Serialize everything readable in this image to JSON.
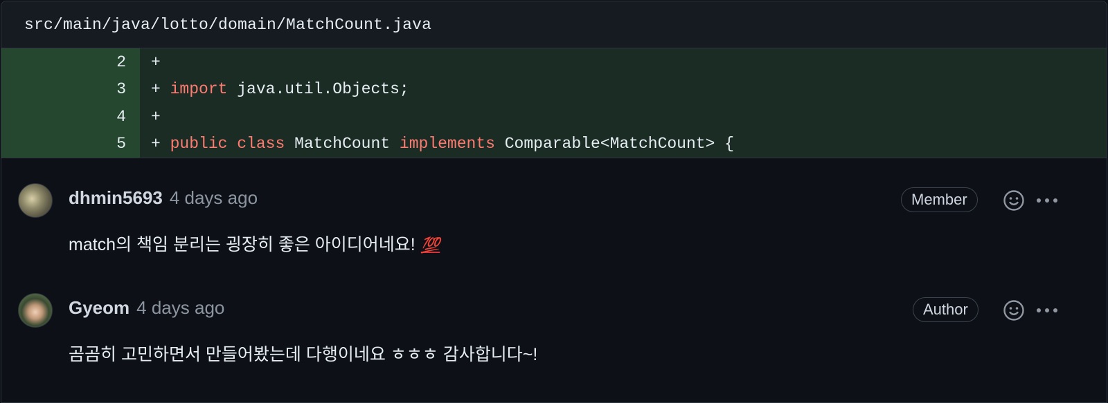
{
  "file": {
    "path": "src/main/java/lotto/domain/MatchCount.java"
  },
  "diff": {
    "lines": [
      {
        "num": "2",
        "prefix": "+ ",
        "tokens": []
      },
      {
        "num": "3",
        "prefix": "+ ",
        "tokens": [
          {
            "text": "import",
            "kw": true
          },
          {
            "text": " java.util.Objects;",
            "kw": false
          }
        ]
      },
      {
        "num": "4",
        "prefix": "+ ",
        "tokens": []
      },
      {
        "num": "5",
        "prefix": "+ ",
        "tokens": [
          {
            "text": "public",
            "kw": true
          },
          {
            "text": " ",
            "kw": false
          },
          {
            "text": "class",
            "kw": true
          },
          {
            "text": " MatchCount ",
            "kw": false
          },
          {
            "text": "implements",
            "kw": true
          },
          {
            "text": " Comparable<MatchCount> {",
            "kw": false
          }
        ]
      }
    ]
  },
  "comments": [
    {
      "author": "dhmin5693",
      "time": "4 days ago",
      "badge": "Member",
      "body": "match의 책임 분리는 굉장히 좋은 아이디어네요!",
      "emoji": "💯"
    },
    {
      "author": "Gyeom",
      "time": "4 days ago",
      "badge": "Author",
      "body": "곰곰히 고민하면서 만들어봤는데 다행이네요 ㅎㅎㅎ 감사합니다~!",
      "emoji": ""
    }
  ],
  "colors": {
    "background": "#0d1117",
    "diff_added_bg": "#1a2c23",
    "diff_added_gutter": "#25472f",
    "keyword": "#ff7b72",
    "muted_text": "#8d96a0"
  },
  "icons": {
    "reaction": "smiley-icon",
    "more": "kebab-horizontal-icon"
  }
}
